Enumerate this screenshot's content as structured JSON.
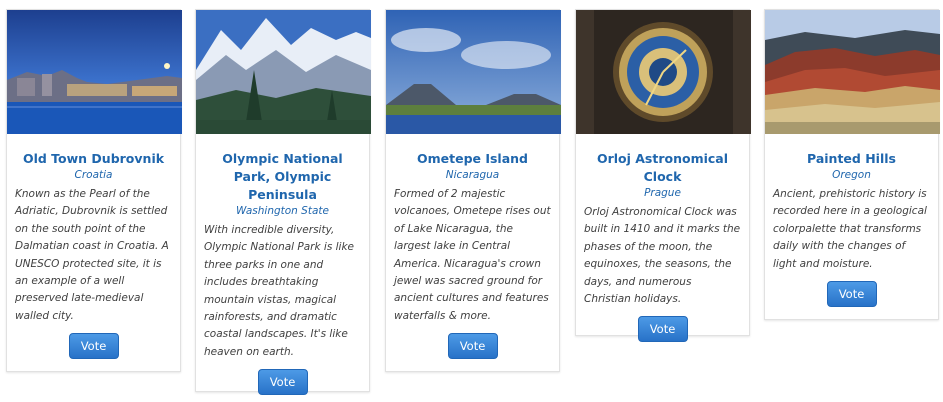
{
  "cards": [
    {
      "title": "Old Town Dubrovnik",
      "subtitle": "Croatia",
      "description": "Known as the Pearl of the Adriatic, Dubrovnik is settled on the south point of the Dalmatian coast in Croatia. A UNESCO protected site, it is an example of a well preserved late-medieval walled city.",
      "vote_label": "Vote"
    },
    {
      "title": "Olympic National Park, Olympic Peninsula",
      "subtitle": "Washington State",
      "description": "With incredible diversity, Olympic National Park is like three parks in one and includes breathtaking mountain vistas, magical rainforests, and dramatic coastal landscapes. It's like heaven on earth.",
      "vote_label": "Vote"
    },
    {
      "title": "Ometepe Island",
      "subtitle": "Nicaragua",
      "description": "Formed of 2 majestic volcanoes, Ometepe rises out of Lake Nicaragua, the largest lake in Central America. Nicaragua's crown jewel was sacred ground for ancient cultures and features waterfalls & more.",
      "vote_label": "Vote"
    },
    {
      "title": "Orloj Astronomical Clock",
      "subtitle": "Prague",
      "description": "Orloj Astronomical Clock was built in 1410 and it marks the phases of the moon, the equinoxes, the seasons, the days, and numerous Christian holidays.",
      "vote_label": "Vote"
    },
    {
      "title": "Painted Hills",
      "subtitle": "Oregon",
      "description": "Ancient, prehistoric history is recorded here in a geological colorpalette that transforms daily with the changes of light and moisture.",
      "vote_label": "Vote"
    }
  ]
}
